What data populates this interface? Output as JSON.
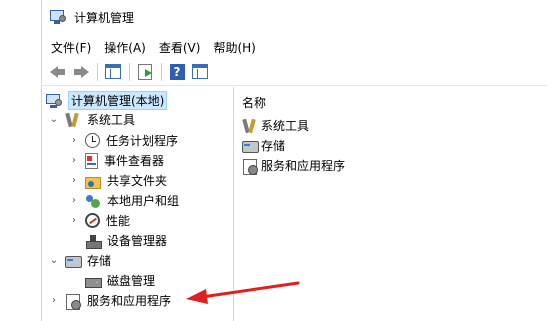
{
  "window": {
    "title": "计算机管理"
  },
  "menubar": {
    "items": [
      {
        "label": "文件(F)"
      },
      {
        "label": "操作(A)"
      },
      {
        "label": "查看(V)"
      },
      {
        "label": "帮助(H)"
      }
    ]
  },
  "toolbar": {
    "buttons": [
      "back-arrow-icon",
      "forward-arrow-icon",
      "show-hide-tree-icon",
      "export-list-icon",
      "help-icon",
      "show-hide-action-pane-icon"
    ]
  },
  "tree": {
    "root": {
      "label": "计算机管理(本地)",
      "selected": true
    },
    "system_tools": {
      "label": "系统工具",
      "expanded": true,
      "children": [
        {
          "label": "任务计划程序",
          "icon": "clock-icon"
        },
        {
          "label": "事件查看器",
          "icon": "event-viewer-icon"
        },
        {
          "label": "共享文件夹",
          "icon": "shared-folder-icon"
        },
        {
          "label": "本地用户和组",
          "icon": "users-icon"
        },
        {
          "label": "性能",
          "icon": "performance-icon"
        },
        {
          "label": "设备管理器",
          "icon": "device-manager-icon"
        }
      ]
    },
    "storage": {
      "label": "存储",
      "expanded": true,
      "children": [
        {
          "label": "磁盘管理",
          "icon": "disk-icon"
        }
      ]
    },
    "services": {
      "label": "服务和应用程序",
      "expanded": false
    }
  },
  "detail": {
    "column_header": "名称",
    "items": [
      {
        "label": "系统工具",
        "icon": "tools-icon"
      },
      {
        "label": "存储",
        "icon": "storage-icon"
      },
      {
        "label": "服务和应用程序",
        "icon": "services-icon"
      }
    ]
  },
  "annotation": {
    "arrow_color": "#e02020"
  }
}
